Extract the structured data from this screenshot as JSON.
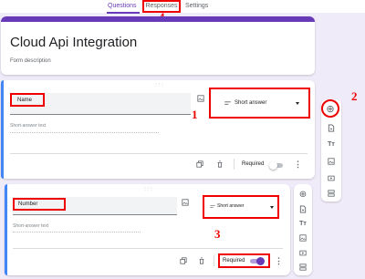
{
  "tabs": [
    {
      "label": "Questions"
    },
    {
      "label": "Responses"
    },
    {
      "label": "Settings"
    }
  ],
  "form": {
    "title": "Cloud Api Integration",
    "description": "Form description"
  },
  "questions": [
    {
      "title": "Name",
      "answer_placeholder": "Short-answer text",
      "type": "Short answer",
      "required_label": "Required",
      "required": false
    },
    {
      "title": "Number",
      "answer_placeholder": "Short-answer text",
      "type": "Short answer",
      "required_label": "Required",
      "required": true
    }
  ],
  "annotations": {
    "n1": "1",
    "n2": "2",
    "n3": "3",
    "n4": "4"
  },
  "icons": {
    "drag_handle": "⋮⋮⋮",
    "add": "⊕",
    "import": "import-questions-icon",
    "title": "Tт",
    "image": "image-icon",
    "video": "video-icon",
    "section": "section-icon",
    "more": "⋮"
  },
  "colors": {
    "accent": "#673ab7",
    "annotation": "#e00000",
    "left_bar": "#4285f4"
  }
}
